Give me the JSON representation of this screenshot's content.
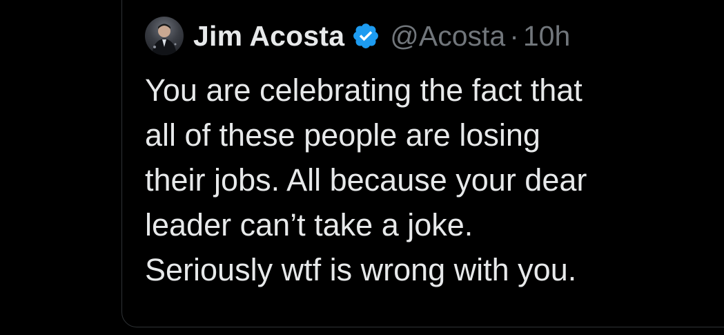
{
  "author": {
    "display_name": "Jim Acosta",
    "handle": "@Acosta",
    "separator": "·",
    "time": "10h",
    "verified": true,
    "verified_color": "#1d9bf0"
  },
  "tweet": {
    "lines": [
      "You are celebrating the fact that",
      "all of these people are losing",
      "their jobs. All because your dear",
      "leader can’t take a joke.",
      "Seriously wtf is wrong with you."
    ]
  },
  "theme": {
    "background": "#000000",
    "text": "#e7e9ea",
    "muted": "#71767b",
    "border": "#2f3336"
  }
}
